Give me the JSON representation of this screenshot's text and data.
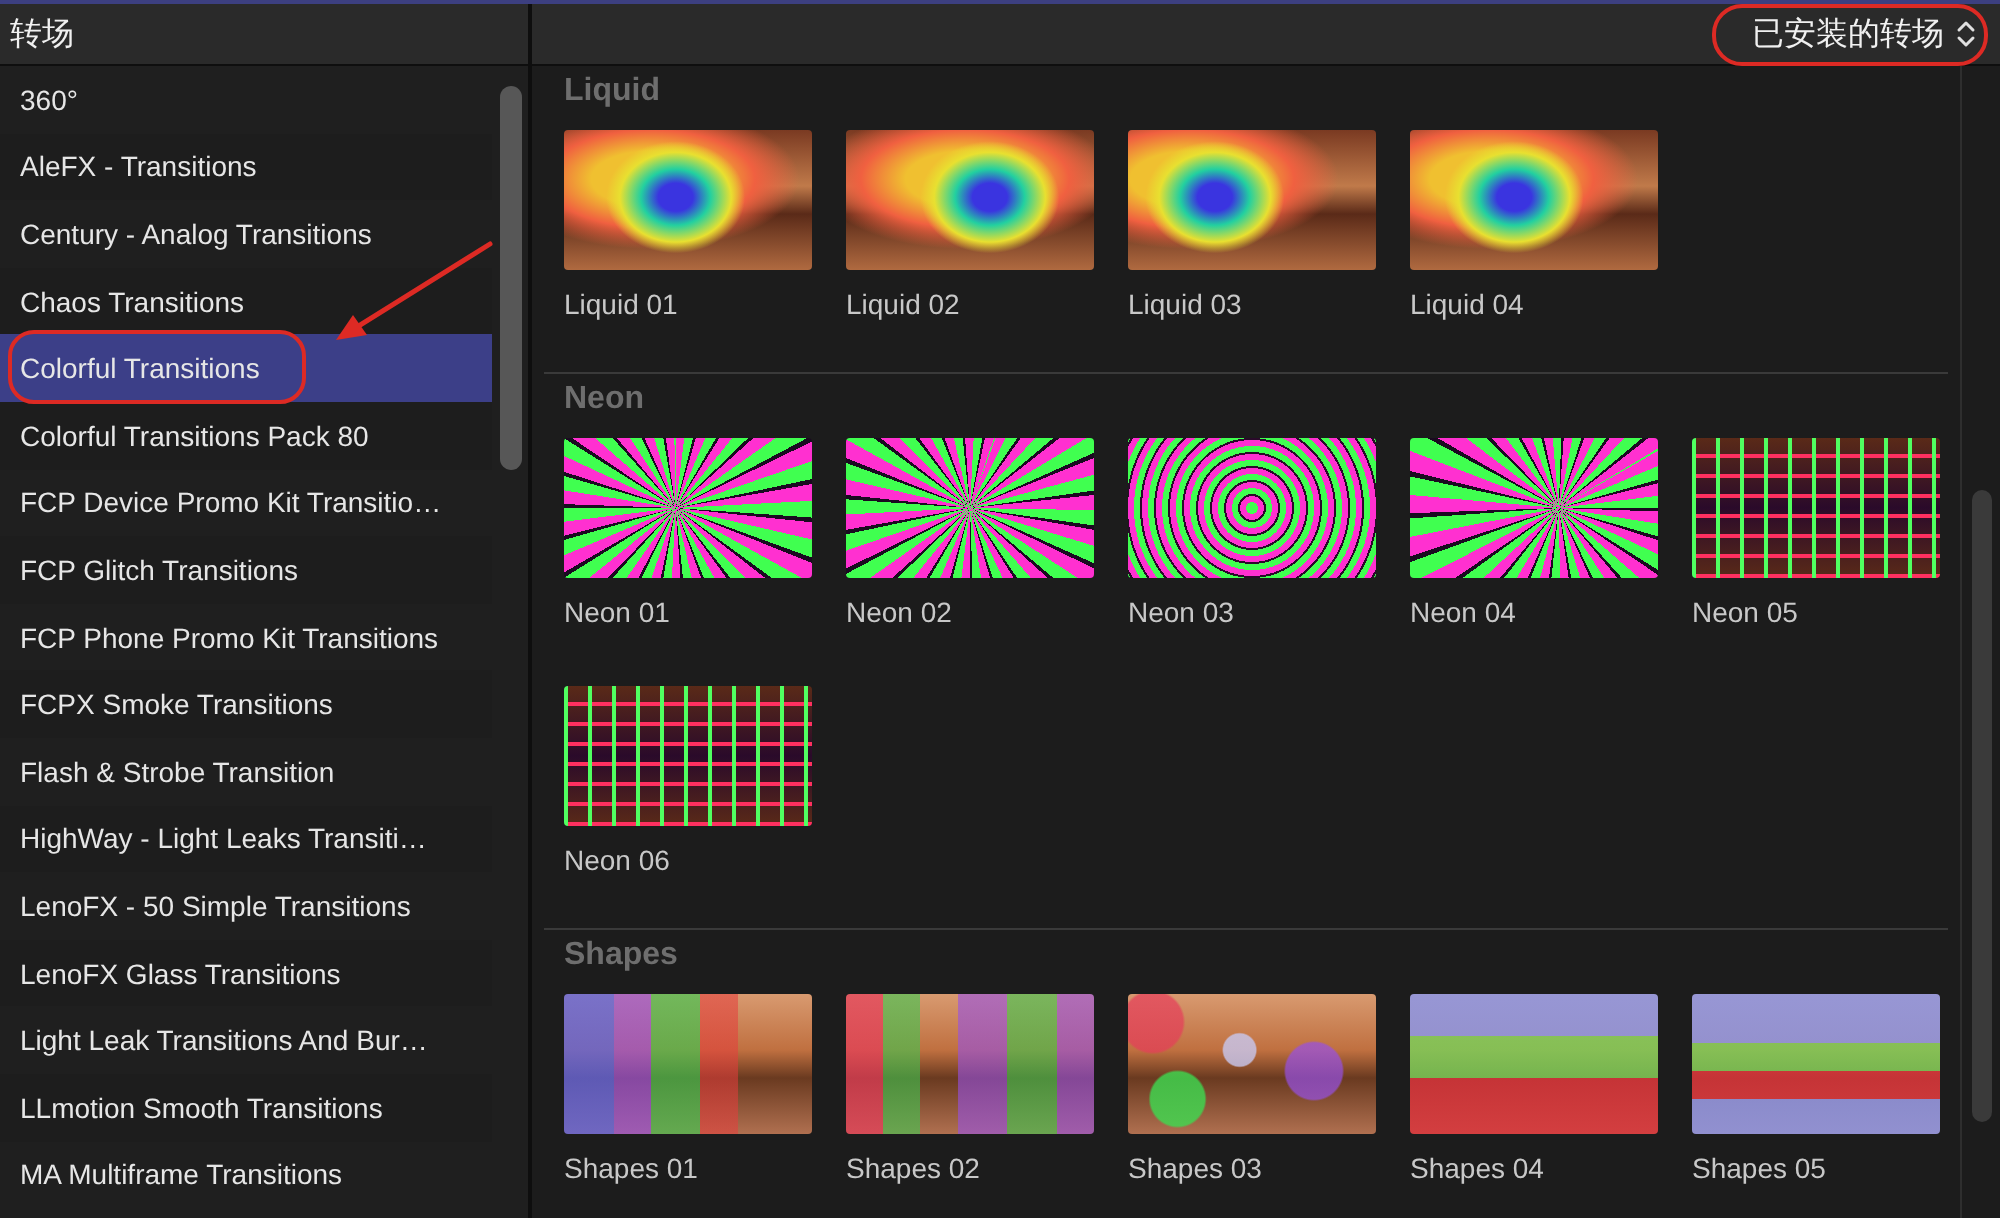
{
  "panel": {
    "title": "转场"
  },
  "filter": {
    "value": "已安装的转场"
  },
  "sidebar": {
    "items": [
      {
        "label": "360°",
        "selected": false
      },
      {
        "label": "AleFX - Transitions",
        "selected": false
      },
      {
        "label": "Century - Analog Transitions",
        "selected": false
      },
      {
        "label": "Chaos Transitions",
        "selected": false
      },
      {
        "label": "Colorful Transitions",
        "selected": true
      },
      {
        "label": "Colorful Transitions Pack 80",
        "selected": false
      },
      {
        "label": "FCP Device Promo Kit Transitio…",
        "selected": false
      },
      {
        "label": "FCP Glitch Transitions",
        "selected": false
      },
      {
        "label": "FCP Phone Promo Kit Transitions",
        "selected": false
      },
      {
        "label": "FCPX Smoke Transitions",
        "selected": false
      },
      {
        "label": "Flash & Strobe Transition",
        "selected": false
      },
      {
        "label": "HighWay - Light Leaks Transiti…",
        "selected": false
      },
      {
        "label": "LenoFX - 50 Simple Transitions",
        "selected": false
      },
      {
        "label": "LenoFX Glass Transitions",
        "selected": false
      },
      {
        "label": "Light Leak Transitions And Bur…",
        "selected": false
      },
      {
        "label": "LLmotion Smooth Transitions",
        "selected": false
      },
      {
        "label": "MA Multiframe Transitions",
        "selected": false
      }
    ]
  },
  "sections": [
    {
      "title": "Liquid",
      "kind": "liquid",
      "items": [
        {
          "label": "Liquid 01"
        },
        {
          "label": "Liquid 02"
        },
        {
          "label": "Liquid 03"
        },
        {
          "label": "Liquid 04"
        }
      ]
    },
    {
      "title": "Neon",
      "kind": "neon",
      "items": [
        {
          "label": "Neon 01"
        },
        {
          "label": "Neon 02"
        },
        {
          "label": "Neon 03"
        },
        {
          "label": "Neon 04"
        },
        {
          "label": "Neon 05"
        },
        {
          "label": "Neon 06"
        }
      ]
    },
    {
      "title": "Shapes",
      "kind": "shapes",
      "items": [
        {
          "label": "Shapes 01"
        },
        {
          "label": "Shapes 02"
        },
        {
          "label": "Shapes 03"
        },
        {
          "label": "Shapes 04"
        },
        {
          "label": "Shapes 05"
        }
      ]
    }
  ]
}
